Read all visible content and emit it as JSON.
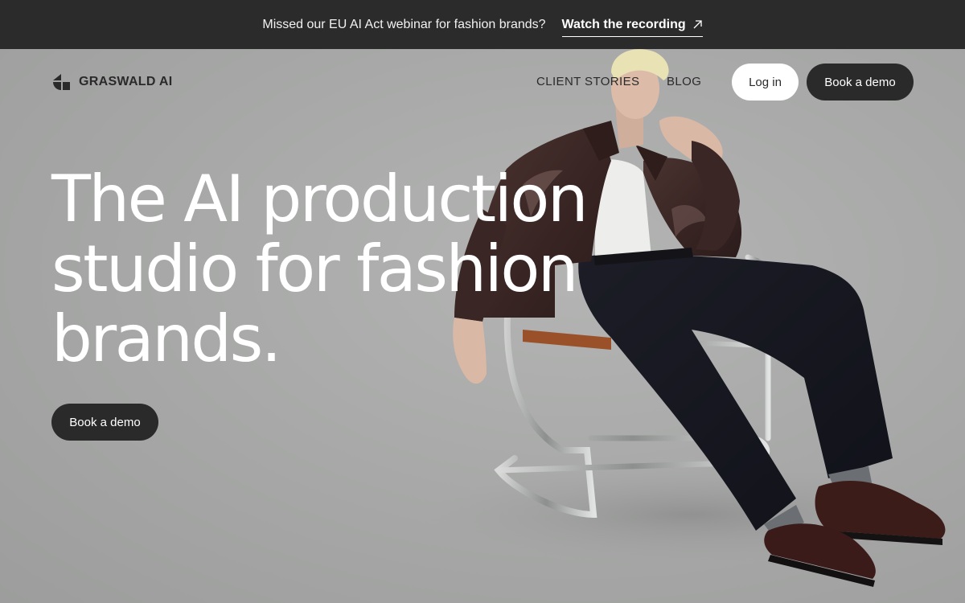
{
  "announcement": {
    "message": "Missed our EU AI Act webinar for fashion brands?",
    "link_label": "Watch the recording",
    "link_icon": "arrow-up-right-icon"
  },
  "nav": {
    "brand": "GRASWALD AI",
    "logo_icon": "graswald-logo-icon",
    "links": [
      "CLIENT STORIES",
      "BLOG"
    ],
    "login_label": "Log in",
    "demo_label": "Book a demo"
  },
  "hero": {
    "headline_lines": [
      "The AI production",
      "studio for fashion",
      "brands."
    ],
    "cta_label": "Book a demo",
    "image": "model-seated-in-chrome-chair"
  },
  "colors": {
    "announcement_bg": "#2b2b2b",
    "background": "#a9aaa9",
    "dark_button": "#2a2a2a",
    "light_button": "#ffffff",
    "headline": "#ffffff"
  }
}
